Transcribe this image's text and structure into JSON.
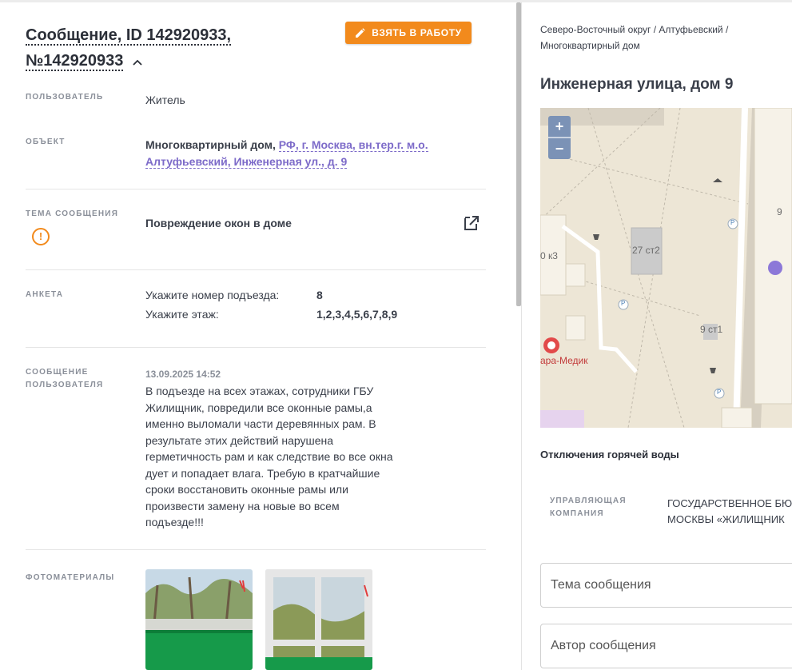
{
  "header": {
    "title_line1": "Сообщение, ID 142920933,",
    "title_line2": "№142920933",
    "chevron": "^",
    "work_button": "ВЗЯТЬ В РАБОТУ"
  },
  "fields": {
    "user_label": "ПОЛЬЗОВАТЕЛЬ",
    "user_value": "Житель",
    "object_label": "ОБЪЕКТ",
    "object_type": "Многоквартирный дом,",
    "object_address_1": "РФ, г. Москва, вн.тер.г. м.о.",
    "object_address_2": "Алтуфьевский, Инженерная ул., д. 9",
    "topic_label": "ТЕМА СООБЩЕНИЯ",
    "topic_value": "Повреждение окон в доме",
    "survey_label": "АНКЕТА",
    "survey": [
      {
        "q": "Укажите номер подъезда:",
        "a": "8"
      },
      {
        "q": "Укажите этаж:",
        "a": "1,2,3,4,5,6,7,8,9"
      }
    ],
    "message_label_1": "СООБЩЕНИЕ",
    "message_label_2": "ПОЛЬЗОВАТЕЛЯ",
    "message_date": "13.09.2025 14:52",
    "message_lines": [
      "В подъезде на всех этажах, сотрудники ГБУ",
      "Жилищник, повредили все оконные рамы,а",
      "именно выломали части деревянных рам. В",
      "результате этих действий нарушена",
      "герметичность рам и как следствие во все окна",
      "дует и попадает влага. Требую в кратчайшие",
      "сроки восстановить оконные рамы или",
      "произвести замену на новые во всем",
      "подъезде!!!"
    ],
    "photos_label": "ФОТОМАТЕРИАЛЫ"
  },
  "right": {
    "breadcrumb_line1": "Северо-Восточный округ / Алтуфьевский /",
    "breadcrumb_line2": "Многоквартирный дом",
    "address": "Инженерная улица, дом 9",
    "map_labels": {
      "b1": "27 ст2",
      "b2": "9 ст1",
      "b3": "0 к3",
      "b4": "9",
      "poi": "ара-Медик",
      "zoom_in": "+",
      "zoom_out": "−",
      "parking": "P"
    },
    "hot_water": "Отключения горячей воды",
    "mc_label_1": "УПРАВЛЯЮЩАЯ",
    "mc_label_2": "КОМПАНИЯ",
    "mc_value_1": "ГОСУДАРСТВЕННОЕ БЮ",
    "mc_value_2": "МОСКВЫ «ЖИЛИЩНИК",
    "topic_placeholder": "Тема сообщения",
    "author_placeholder": "Автор сообщения"
  },
  "colors": {
    "accent": "#f28a1c",
    "link": "#7d6bc9",
    "map_bg": "#ede6d6",
    "marker": "#8c78d8"
  }
}
